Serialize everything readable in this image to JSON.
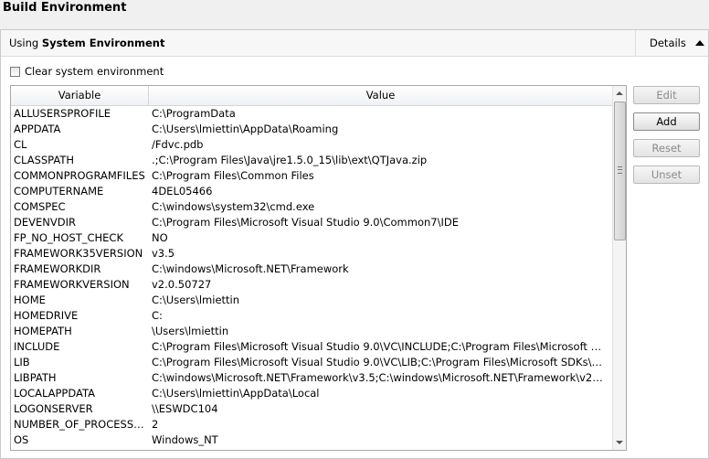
{
  "section": {
    "title": "Build Environment"
  },
  "header": {
    "using_prefix": "Using ",
    "using_value": "System Environment",
    "details_label": "Details"
  },
  "clear_checkbox": {
    "label": "Clear system environment",
    "checked": false
  },
  "table": {
    "columns": [
      "Variable",
      "Value"
    ],
    "rows": [
      [
        "ALLUSERSPROFILE",
        "C:\\ProgramData"
      ],
      [
        "APPDATA",
        "C:\\Users\\lmiettin\\AppData\\Roaming"
      ],
      [
        "CL",
        "/Fdvc.pdb"
      ],
      [
        "CLASSPATH",
        ".;C:\\Program Files\\Java\\jre1.5.0_15\\lib\\ext\\QTJava.zip"
      ],
      [
        "COMMONPROGRAMFILES",
        "C:\\Program Files\\Common Files"
      ],
      [
        "COMPUTERNAME",
        "4DEL05466"
      ],
      [
        "COMSPEC",
        "C:\\windows\\system32\\cmd.exe"
      ],
      [
        "DEVENVDIR",
        "C:\\Program Files\\Microsoft Visual Studio 9.0\\Common7\\IDE"
      ],
      [
        "FP_NO_HOST_CHECK",
        "NO"
      ],
      [
        "FRAMEWORK35VERSION",
        "v3.5"
      ],
      [
        "FRAMEWORKDIR",
        "C:\\windows\\Microsoft.NET\\Framework"
      ],
      [
        "FRAMEWORKVERSION",
        "v2.0.50727"
      ],
      [
        "HOME",
        "C:\\Users\\lmiettin"
      ],
      [
        "HOMEDRIVE",
        "C:"
      ],
      [
        "HOMEPATH",
        "\\Users\\lmiettin"
      ],
      [
        "INCLUDE",
        "C:\\Program Files\\Microsoft Visual Studio 9.0\\VC\\INCLUDE;C:\\Program Files\\Microsoft SDKs\\..."
      ],
      [
        "LIB",
        "C:\\Program Files\\Microsoft Visual Studio 9.0\\VC\\LIB;C:\\Program Files\\Microsoft SDKs\\Wind..."
      ],
      [
        "LIBPATH",
        "C:\\windows\\Microsoft.NET\\Framework\\v3.5;C:\\windows\\Microsoft.NET\\Framework\\v2.0.50..."
      ],
      [
        "LOCALAPPDATA",
        "C:\\Users\\lmiettin\\AppData\\Local"
      ],
      [
        "LOGONSERVER",
        "\\\\ESWDC104"
      ],
      [
        "NUMBER_OF_PROCESSORS",
        "2"
      ],
      [
        "OS",
        "Windows_NT"
      ]
    ]
  },
  "buttons": {
    "edit": "Edit",
    "add": "Add",
    "reset": "Reset",
    "unset": "Unset"
  },
  "icons": {
    "details_toggle": "triangle-up-icon",
    "scroll_up": "scroll-up-arrow-icon",
    "scroll_down": "scroll-down-arrow-icon"
  }
}
